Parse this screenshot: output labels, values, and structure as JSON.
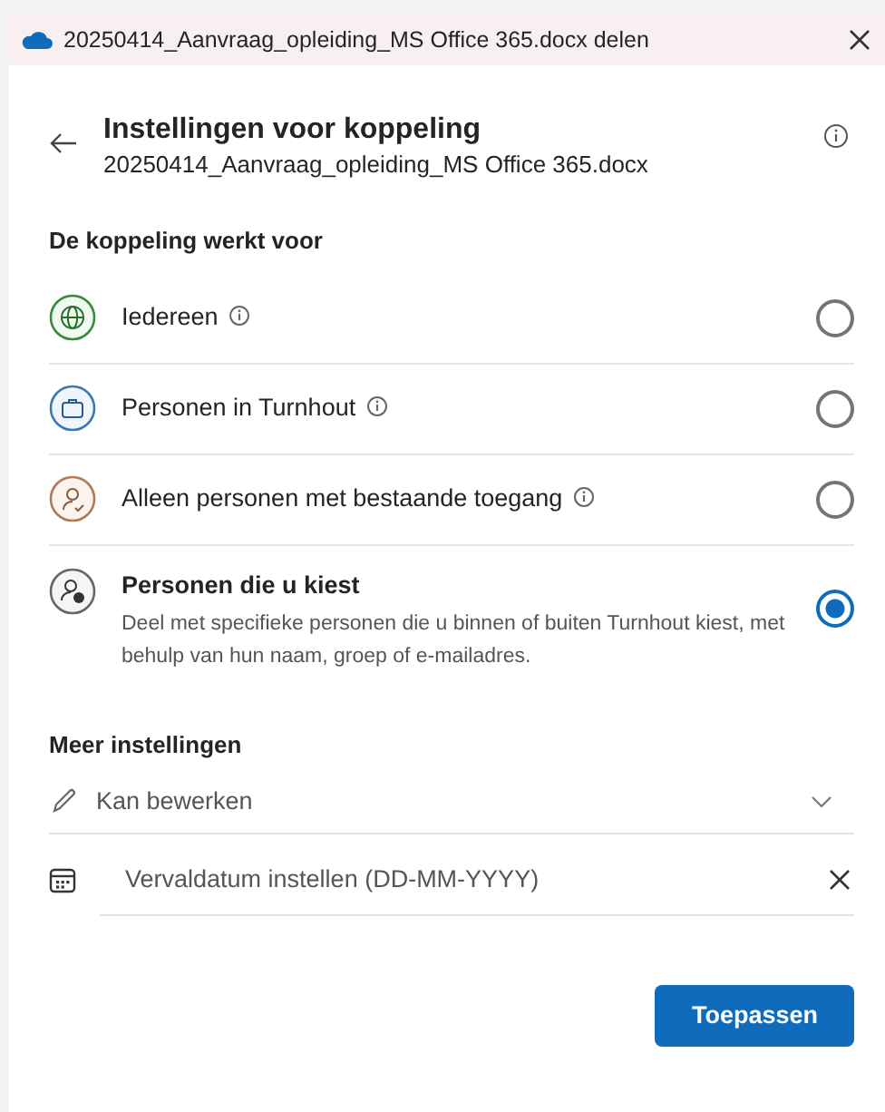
{
  "window": {
    "title": "20250414_Aanvraag_opleiding_MS Office 365.docx delen"
  },
  "header": {
    "title": "Instellingen voor koppeling",
    "subtitle": "20250414_Aanvraag_opleiding_MS Office 365.docx"
  },
  "audience": {
    "heading": "De koppeling werkt voor",
    "options": [
      {
        "kind": "globe",
        "label": "Iedereen",
        "info": true,
        "selected": false
      },
      {
        "kind": "organization",
        "label": "Personen in Turnhout",
        "info": true,
        "selected": false
      },
      {
        "kind": "existing",
        "label": "Alleen personen met bestaande toegang",
        "info": true,
        "selected": false
      },
      {
        "kind": "specific",
        "label": "Personen die u kiest",
        "info": false,
        "description": "Deel met specifieke personen die u binnen of buiten Turnhout kiest, met behulp van hun naam, groep of e-mailadres.",
        "selected": true
      }
    ]
  },
  "more_settings": {
    "heading": "Meer instellingen",
    "permission": "Kan bewerken",
    "expiry": {
      "placeholder": "Vervaldatum instellen (DD-MM-YYYY)"
    }
  },
  "apply_button": "Toepassen"
}
